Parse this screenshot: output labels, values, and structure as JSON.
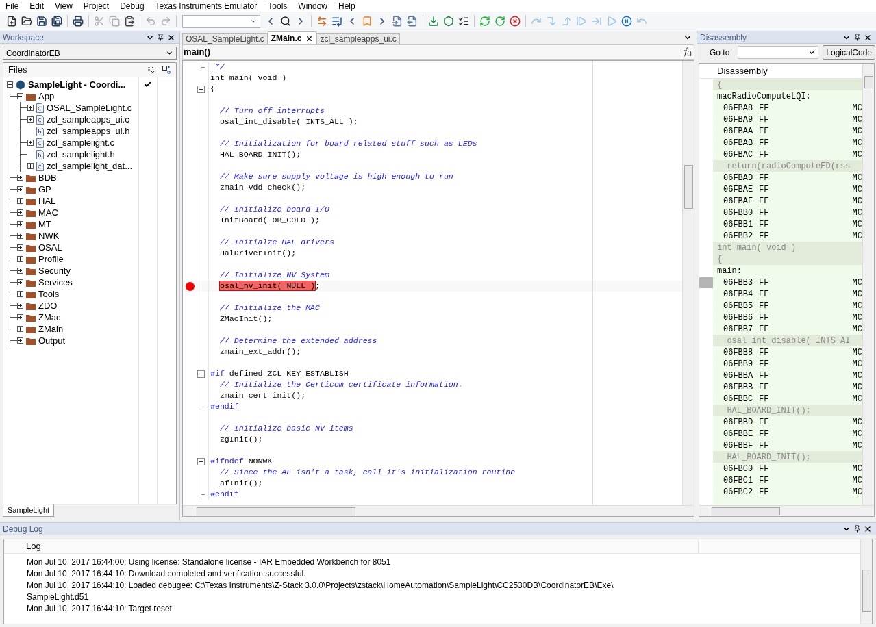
{
  "menu": [
    "File",
    "Edit",
    "View",
    "Project",
    "Debug",
    "Texas Instruments Emulator",
    "Tools",
    "Window",
    "Help"
  ],
  "toolbar": [
    {
      "kind": "new-file",
      "disabled": false
    },
    {
      "kind": "open",
      "disabled": false
    },
    {
      "kind": "save",
      "disabled": false
    },
    {
      "kind": "save-all",
      "disabled": false
    },
    {
      "kind": "separator"
    },
    {
      "kind": "print",
      "disabled": false
    },
    {
      "kind": "separator"
    },
    {
      "kind": "cut",
      "disabled": true
    },
    {
      "kind": "copy",
      "disabled": true
    },
    {
      "kind": "paste",
      "disabled": false
    },
    {
      "kind": "separator"
    },
    {
      "kind": "undo",
      "disabled": true
    },
    {
      "kind": "redo",
      "disabled": true
    },
    {
      "kind": "separator"
    },
    {
      "kind": "search-combo"
    },
    {
      "kind": "prev",
      "disabled": false
    },
    {
      "kind": "find",
      "disabled": false
    },
    {
      "kind": "next",
      "disabled": false
    },
    {
      "kind": "separator"
    },
    {
      "kind": "swap",
      "disabled": false
    },
    {
      "kind": "goto",
      "disabled": false
    },
    {
      "kind": "prev",
      "disabled": false
    },
    {
      "kind": "bookmark",
      "disabled": false
    },
    {
      "kind": "next",
      "disabled": false
    },
    {
      "kind": "nav-back",
      "disabled": false
    },
    {
      "kind": "nav-forward",
      "disabled": false
    },
    {
      "kind": "separator"
    },
    {
      "kind": "download",
      "disabled": false
    },
    {
      "kind": "download-debug",
      "disabled": false
    },
    {
      "kind": "breakpoints",
      "disabled": false
    },
    {
      "kind": "separator"
    },
    {
      "kind": "rebuild",
      "disabled": false
    },
    {
      "kind": "restart",
      "disabled": false
    },
    {
      "kind": "stop",
      "disabled": false
    },
    {
      "kind": "separator"
    },
    {
      "kind": "step-over",
      "disabled": true
    },
    {
      "kind": "step-into",
      "disabled": true
    },
    {
      "kind": "step-out",
      "disabled": true
    },
    {
      "kind": "next-statement",
      "disabled": true
    },
    {
      "kind": "run-to-cursor",
      "disabled": true
    },
    {
      "kind": "go",
      "disabled": true
    },
    {
      "kind": "break",
      "disabled": false
    },
    {
      "kind": "reset",
      "disabled": true
    }
  ],
  "workspace": {
    "title": "Workspace",
    "configuration": "CoordinatorEB",
    "header": "Files",
    "tree": [
      {
        "label": "SampleLight - Coordi...",
        "kind": "project",
        "expanded": true,
        "checked": true,
        "children": [
          {
            "label": "App",
            "kind": "folder",
            "expanded": true,
            "children": [
              {
                "label": "OSAL_SampleLight.c",
                "kind": "c",
                "expanded": false
              },
              {
                "label": "zcl_sampleapps_ui.c",
                "kind": "c",
                "expanded": false
              },
              {
                "label": "zcl_sampleapps_ui.h",
                "kind": "h"
              },
              {
                "label": "zcl_samplelight.c",
                "kind": "c",
                "expanded": false
              },
              {
                "label": "zcl_samplelight.h",
                "kind": "h"
              },
              {
                "label": "zcl_samplelight_dat...",
                "kind": "c",
                "expanded": false
              }
            ]
          },
          {
            "label": "BDB",
            "kind": "folder",
            "expanded": false
          },
          {
            "label": "GP",
            "kind": "folder",
            "expanded": false
          },
          {
            "label": "HAL",
            "kind": "folder",
            "expanded": false
          },
          {
            "label": "MAC",
            "kind": "folder",
            "expanded": false
          },
          {
            "label": "MT",
            "kind": "folder",
            "expanded": false
          },
          {
            "label": "NWK",
            "kind": "folder",
            "expanded": false
          },
          {
            "label": "OSAL",
            "kind": "folder",
            "expanded": false
          },
          {
            "label": "Profile",
            "kind": "folder",
            "expanded": false
          },
          {
            "label": "Security",
            "kind": "folder",
            "expanded": false
          },
          {
            "label": "Services",
            "kind": "folder",
            "expanded": false
          },
          {
            "label": "Tools",
            "kind": "folder",
            "expanded": false
          },
          {
            "label": "ZDO",
            "kind": "folder",
            "expanded": false
          },
          {
            "label": "ZMac",
            "kind": "folder",
            "expanded": false
          },
          {
            "label": "ZMain",
            "kind": "folder",
            "expanded": false
          },
          {
            "label": "Output",
            "kind": "folder",
            "expanded": false
          }
        ]
      }
    ],
    "tabs": [
      {
        "label": "SampleLight",
        "selected": true
      }
    ]
  },
  "editor": {
    "tabs": [
      {
        "label": "OSAL_SampleLight.c",
        "selected": false,
        "closable": false
      },
      {
        "label": "ZMain.c",
        "selected": true,
        "closable": true
      },
      {
        "label": "zcl_sampleapps_ui.c",
        "selected": false,
        "closable": false
      }
    ],
    "function": "main()",
    "lines": [
      {
        "in_block": false,
        "collapsible": false,
        "fold_end": true,
        "breakpoint": false,
        "segments": [
          {
            "kind": "comment",
            "text": " */"
          }
        ]
      },
      {
        "in_block": false,
        "collapsible": false,
        "fold_end": false,
        "breakpoint": false,
        "segments": [
          {
            "kind": "code",
            "text": "int main( void )"
          }
        ]
      },
      {
        "in_block": false,
        "collapsible": true,
        "fold_end": false,
        "breakpoint": false,
        "segments": [
          {
            "kind": "code",
            "text": "{"
          }
        ]
      },
      {
        "in_block": true,
        "collapsible": false,
        "fold_end": false,
        "breakpoint": false
      },
      {
        "in_block": true,
        "collapsible": false,
        "fold_end": false,
        "breakpoint": false,
        "segments": [
          {
            "kind": "comment",
            "text": "  // Turn off interrupts"
          }
        ]
      },
      {
        "in_block": true,
        "collapsible": false,
        "fold_end": false,
        "breakpoint": false,
        "segments": [
          {
            "kind": "code",
            "text": "  osal_int_disable( INTS_ALL );"
          }
        ]
      },
      {
        "in_block": true,
        "collapsible": false,
        "fold_end": false,
        "breakpoint": false
      },
      {
        "in_block": true,
        "collapsible": false,
        "fold_end": false,
        "breakpoint": false,
        "segments": [
          {
            "kind": "comment",
            "text": "  // Initialization for board related stuff such as LEDs"
          }
        ]
      },
      {
        "in_block": true,
        "collapsible": false,
        "fold_end": false,
        "breakpoint": false,
        "segments": [
          {
            "kind": "code",
            "text": "  HAL_BOARD_INIT();"
          }
        ]
      },
      {
        "in_block": true,
        "collapsible": false,
        "fold_end": false,
        "breakpoint": false
      },
      {
        "in_block": true,
        "collapsible": false,
        "fold_end": false,
        "breakpoint": false,
        "segments": [
          {
            "kind": "comment",
            "text": "  // Make sure supply voltage is high enough to run"
          }
        ]
      },
      {
        "in_block": true,
        "collapsible": false,
        "fold_end": false,
        "breakpoint": false,
        "segments": [
          {
            "kind": "code",
            "text": "  zmain_vdd_check();"
          }
        ]
      },
      {
        "in_block": true,
        "collapsible": false,
        "fold_end": false,
        "breakpoint": false
      },
      {
        "in_block": true,
        "collapsible": false,
        "fold_end": false,
        "breakpoint": false,
        "segments": [
          {
            "kind": "comment",
            "text": "  // Initialize board I/O"
          }
        ]
      },
      {
        "in_block": true,
        "collapsible": false,
        "fold_end": false,
        "breakpoint": false,
        "segments": [
          {
            "kind": "code",
            "text": "  InitBoard( OB_COLD );"
          }
        ]
      },
      {
        "in_block": true,
        "collapsible": false,
        "fold_end": false,
        "breakpoint": false
      },
      {
        "in_block": true,
        "collapsible": false,
        "fold_end": false,
        "breakpoint": false,
        "segments": [
          {
            "kind": "comment",
            "text": "  // Initialze HAL drivers"
          }
        ]
      },
      {
        "in_block": true,
        "collapsible": false,
        "fold_end": false,
        "breakpoint": false,
        "segments": [
          {
            "kind": "code",
            "text": "  HalDriverInit();"
          }
        ]
      },
      {
        "in_block": true,
        "collapsible": false,
        "fold_end": false,
        "breakpoint": false
      },
      {
        "in_block": true,
        "collapsible": false,
        "fold_end": false,
        "breakpoint": false,
        "segments": [
          {
            "kind": "comment",
            "text": "  // Initialize NV System"
          }
        ]
      },
      {
        "in_block": true,
        "collapsible": false,
        "fold_end": false,
        "breakpoint": true,
        "segments": [
          {
            "kind": "highlight",
            "text": "osal_nv_init( NULL )"
          },
          {
            "kind": "code",
            "text": ";"
          }
        ]
      },
      {
        "in_block": true,
        "collapsible": false,
        "fold_end": false,
        "breakpoint": false
      },
      {
        "in_block": true,
        "collapsible": false,
        "fold_end": false,
        "breakpoint": false,
        "segments": [
          {
            "kind": "comment",
            "text": "  // Initialize the MAC"
          }
        ]
      },
      {
        "in_block": true,
        "collapsible": false,
        "fold_end": false,
        "breakpoint": false,
        "segments": [
          {
            "kind": "code",
            "text": "  ZMacInit();"
          }
        ]
      },
      {
        "in_block": true,
        "collapsible": false,
        "fold_end": false,
        "breakpoint": false
      },
      {
        "in_block": true,
        "collapsible": false,
        "fold_end": false,
        "breakpoint": false,
        "segments": [
          {
            "kind": "comment",
            "text": "  // Determine the extended address"
          }
        ]
      },
      {
        "in_block": true,
        "collapsible": false,
        "fold_end": false,
        "breakpoint": false,
        "segments": [
          {
            "kind": "code",
            "text": "  zmain_ext_addr();"
          }
        ]
      },
      {
        "in_block": true,
        "collapsible": false,
        "fold_end": false,
        "breakpoint": false
      },
      {
        "in_block": true,
        "collapsible": true,
        "fold_end": false,
        "breakpoint": false,
        "segments": [
          {
            "kind": "directive",
            "text": "#if"
          },
          {
            "kind": "code",
            "text": " defined ZCL_KEY_ESTABLISH"
          }
        ]
      },
      {
        "in_block": true,
        "collapsible": false,
        "fold_end": false,
        "breakpoint": false,
        "segments": [
          {
            "kind": "comment",
            "text": "  // Initialize the Certicom certificate information."
          }
        ]
      },
      {
        "in_block": true,
        "collapsible": false,
        "fold_end": false,
        "breakpoint": false,
        "segments": [
          {
            "kind": "code",
            "text": "  zmain_cert_init();"
          }
        ]
      },
      {
        "in_block": true,
        "collapsible": false,
        "fold_end": true,
        "breakpoint": false,
        "segments": [
          {
            "kind": "directive",
            "text": "#endif"
          }
        ]
      },
      {
        "in_block": true,
        "collapsible": false,
        "fold_end": false,
        "breakpoint": false
      },
      {
        "in_block": true,
        "collapsible": false,
        "fold_end": false,
        "breakpoint": false,
        "segments": [
          {
            "kind": "comment",
            "text": "  // Initialize basic NV items"
          }
        ]
      },
      {
        "in_block": true,
        "collapsible": false,
        "fold_end": false,
        "breakpoint": false,
        "segments": [
          {
            "kind": "code",
            "text": "  zgInit();"
          }
        ]
      },
      {
        "in_block": true,
        "collapsible": false,
        "fold_end": false,
        "breakpoint": false
      },
      {
        "in_block": true,
        "collapsible": true,
        "fold_end": false,
        "breakpoint": false,
        "segments": [
          {
            "kind": "directive",
            "text": "#ifndef"
          },
          {
            "kind": "code",
            "text": " NONWK"
          }
        ]
      },
      {
        "in_block": true,
        "collapsible": false,
        "fold_end": false,
        "breakpoint": false,
        "segments": [
          {
            "kind": "comment",
            "text": "  // Since the AF isn't a task, call it's initialization routine"
          }
        ]
      },
      {
        "in_block": true,
        "collapsible": false,
        "fold_end": false,
        "breakpoint": false,
        "segments": [
          {
            "kind": "code",
            "text": "  afInit();"
          }
        ]
      },
      {
        "in_block": true,
        "collapsible": false,
        "fold_end": true,
        "breakpoint": false,
        "segments": [
          {
            "kind": "directive",
            "text": "#endif"
          }
        ]
      }
    ]
  },
  "disassembly": {
    "title": "Disassembly",
    "goto_label": "Go to",
    "mode_button": "LogicalCode",
    "header": "Disassembly",
    "rows": [
      {
        "kind": "source",
        "text": "{",
        "current": false
      },
      {
        "kind": "label",
        "text": "macRadioComputeLQI:",
        "current": false
      },
      {
        "kind": "instr",
        "address": "06FBA8",
        "bytes": "FF",
        "mnemonic": "MC",
        "current": false
      },
      {
        "kind": "instr",
        "address": "06FBA9",
        "bytes": "FF",
        "mnemonic": "MC",
        "current": false
      },
      {
        "kind": "instr",
        "address": "06FBAA",
        "bytes": "FF",
        "mnemonic": "MC",
        "current": false
      },
      {
        "kind": "instr",
        "address": "06FBAB",
        "bytes": "FF",
        "mnemonic": "MC",
        "current": false
      },
      {
        "kind": "instr",
        "address": "06FBAC",
        "bytes": "FF",
        "mnemonic": "MC",
        "current": false
      },
      {
        "kind": "source",
        "text": "  return(radioComputeED(rss",
        "current": false
      },
      {
        "kind": "instr",
        "address": "06FBAD",
        "bytes": "FF",
        "mnemonic": "MC",
        "current": false
      },
      {
        "kind": "instr",
        "address": "06FBAE",
        "bytes": "FF",
        "mnemonic": "MC",
        "current": false
      },
      {
        "kind": "instr",
        "address": "06FBAF",
        "bytes": "FF",
        "mnemonic": "MC",
        "current": false
      },
      {
        "kind": "instr",
        "address": "06FBB0",
        "bytes": "FF",
        "mnemonic": "MC",
        "current": false
      },
      {
        "kind": "instr",
        "address": "06FBB1",
        "bytes": "FF",
        "mnemonic": "MC",
        "current": false
      },
      {
        "kind": "instr",
        "address": "06FBB2",
        "bytes": "FF",
        "mnemonic": "MC",
        "current": false
      },
      {
        "kind": "source",
        "text": "int main( void )",
        "current": false
      },
      {
        "kind": "source",
        "text": "{",
        "current": false
      },
      {
        "kind": "label",
        "text": "main:",
        "current": false
      },
      {
        "kind": "instr",
        "address": "06FBB3",
        "bytes": "FF",
        "mnemonic": "MC",
        "current": true
      },
      {
        "kind": "instr",
        "address": "06FBB4",
        "bytes": "FF",
        "mnemonic": "MC",
        "current": false
      },
      {
        "kind": "instr",
        "address": "06FBB5",
        "bytes": "FF",
        "mnemonic": "MC",
        "current": false
      },
      {
        "kind": "instr",
        "address": "06FBB6",
        "bytes": "FF",
        "mnemonic": "MC",
        "current": false
      },
      {
        "kind": "instr",
        "address": "06FBB7",
        "bytes": "FF",
        "mnemonic": "MC",
        "current": false
      },
      {
        "kind": "source",
        "text": "  osal_int_disable( INTS_AI",
        "current": false
      },
      {
        "kind": "instr",
        "address": "06FBB8",
        "bytes": "FF",
        "mnemonic": "MC",
        "current": false
      },
      {
        "kind": "instr",
        "address": "06FBB9",
        "bytes": "FF",
        "mnemonic": "MC",
        "current": false
      },
      {
        "kind": "instr",
        "address": "06FBBA",
        "bytes": "FF",
        "mnemonic": "MC",
        "current": false
      },
      {
        "kind": "instr",
        "address": "06FBBB",
        "bytes": "FF",
        "mnemonic": "MC",
        "current": false
      },
      {
        "kind": "instr",
        "address": "06FBBC",
        "bytes": "FF",
        "mnemonic": "MC",
        "current": false
      },
      {
        "kind": "source",
        "text": "  HAL_BOARD_INIT();",
        "current": false
      },
      {
        "kind": "instr",
        "address": "06FBBD",
        "bytes": "FF",
        "mnemonic": "MC",
        "current": false
      },
      {
        "kind": "instr",
        "address": "06FBBE",
        "bytes": "FF",
        "mnemonic": "MC",
        "current": false
      },
      {
        "kind": "instr",
        "address": "06FBBF",
        "bytes": "FF",
        "mnemonic": "MC",
        "current": false
      },
      {
        "kind": "source",
        "text": "  HAL_BOARD_INIT();",
        "current": false
      },
      {
        "kind": "instr",
        "address": "06FBC0",
        "bytes": "FF",
        "mnemonic": "MC",
        "current": false
      },
      {
        "kind": "instr",
        "address": "06FBC1",
        "bytes": "FF",
        "mnemonic": "MC",
        "current": false
      },
      {
        "kind": "instr",
        "address": "06FBC2",
        "bytes": "FF",
        "mnemonic": "MC",
        "current": false
      }
    ]
  },
  "debug_log": {
    "title": "Debug Log",
    "header": "Log",
    "entries": [
      "Mon Jul 10, 2017 16:44:00: Using license: Standalone license - IAR Embedded Workbench for 8051",
      "Mon Jul 10, 2017 16:44:10: Download completed and verification successful.",
      "Mon Jul 10, 2017 16:44:10: Loaded debugee: C:\\Texas Instruments\\Z-Stack 3.0.0\\Projects\\zstack\\HomeAutomation\\SampleLight\\CC2530DB\\CoordinatorEB\\Exe\\",
      "SampleLight.d51",
      "Mon Jul 10, 2017 16:44:10: Target reset"
    ]
  }
}
